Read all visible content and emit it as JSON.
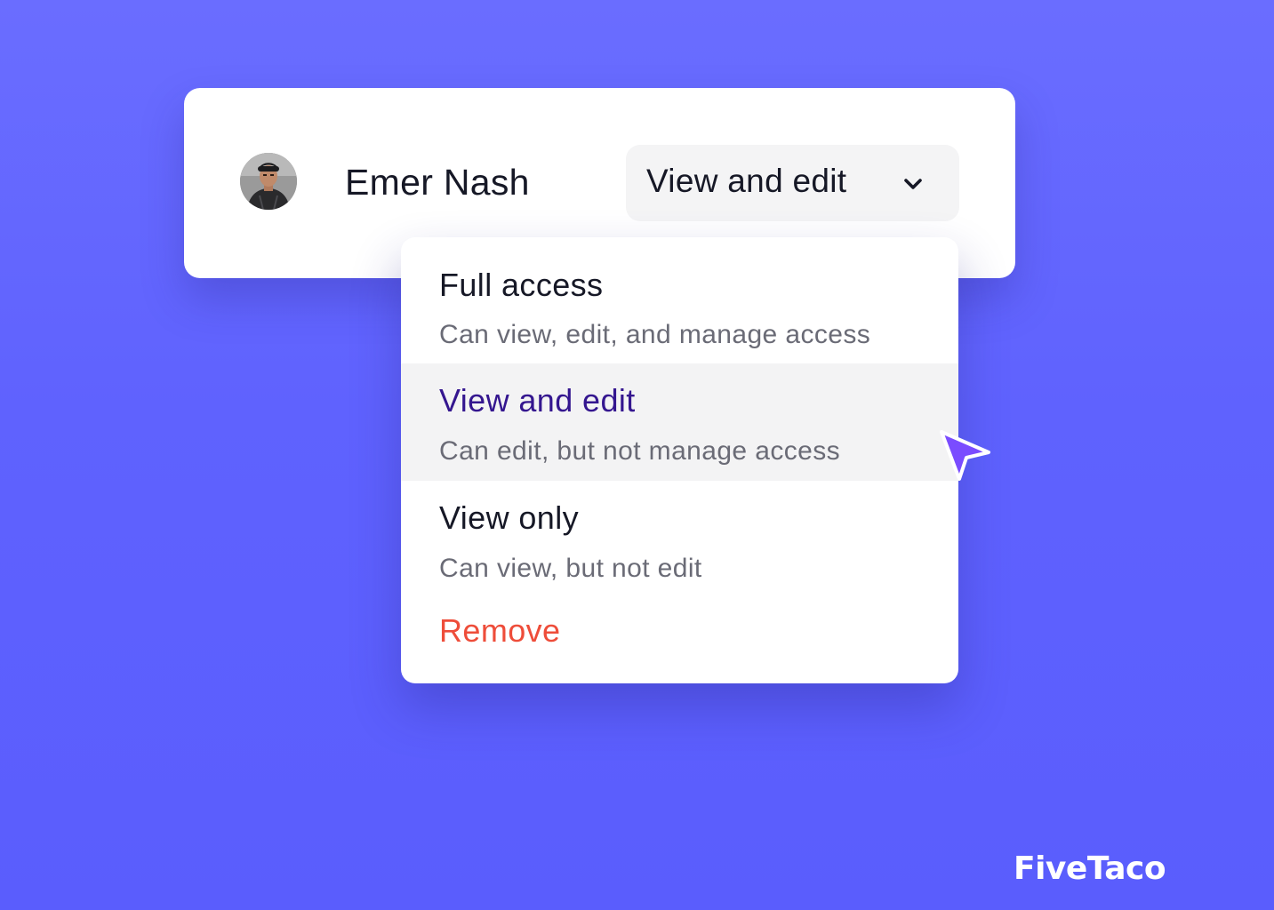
{
  "user": {
    "name": "Emer Nash",
    "avatar_icon": "avatar-photo"
  },
  "permission_select": {
    "value": "View and edit",
    "icon": "chevron-down-icon"
  },
  "menu": {
    "options": [
      {
        "title": "Full access",
        "description": "Can view, edit, and manage access",
        "selected": false
      },
      {
        "title": "View and edit",
        "description": "Can edit, but not manage access",
        "selected": true
      },
      {
        "title": "View only",
        "description": "Can view, but not edit",
        "selected": false
      }
    ],
    "remove_label": "Remove"
  },
  "brand": {
    "logo_text": "FiveTaco"
  },
  "colors": {
    "background": "#5f62fe",
    "selected_text": "#34168f",
    "remove": "#ee4d3a",
    "cursor": "#7a4cff"
  }
}
